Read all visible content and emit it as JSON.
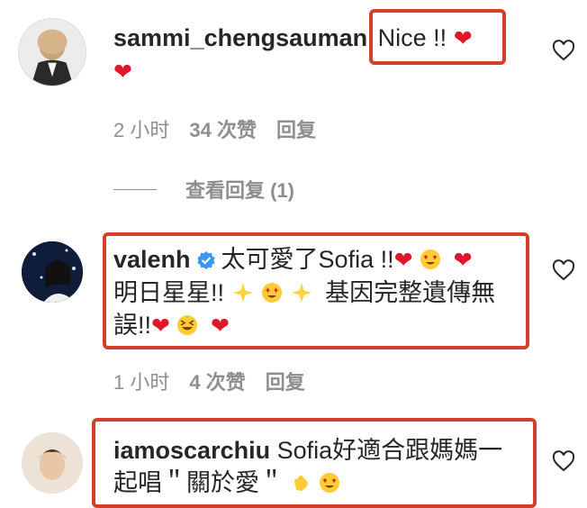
{
  "comments": [
    {
      "username": "sammi_chengsauman",
      "text": "Nice !!",
      "time": "2 小时",
      "likes": "34 次赞",
      "reply": "回复",
      "view_replies": "查看回复 (1)"
    },
    {
      "username": "valenh",
      "text_line1": "太可愛了Sofia !!",
      "text_line2_a": "明日星星!!",
      "text_line2_b": "基因完整遺傳無",
      "text_line3": "誤!!",
      "time": "1 小时",
      "likes": "4 次赞",
      "reply": "回复"
    },
    {
      "username": "iamoscarchiu",
      "text_line1": "Sofia好適合跟媽媽一",
      "text_line2": "起唱＂關於愛＂"
    }
  ],
  "colors": {
    "highlight_box": "#d43f2a",
    "heart": "#e0162b",
    "muted_text": "#8e8e8e",
    "verified_badge": "#3897f0"
  },
  "icons": [
    "heart-outline-icon",
    "red-heart-emoji",
    "verified-badge-icon",
    "heart-eyes-emoji",
    "star-struck-emoji",
    "sparkle-star-emoji",
    "laughing-emoji",
    "clapping-emoji"
  ]
}
